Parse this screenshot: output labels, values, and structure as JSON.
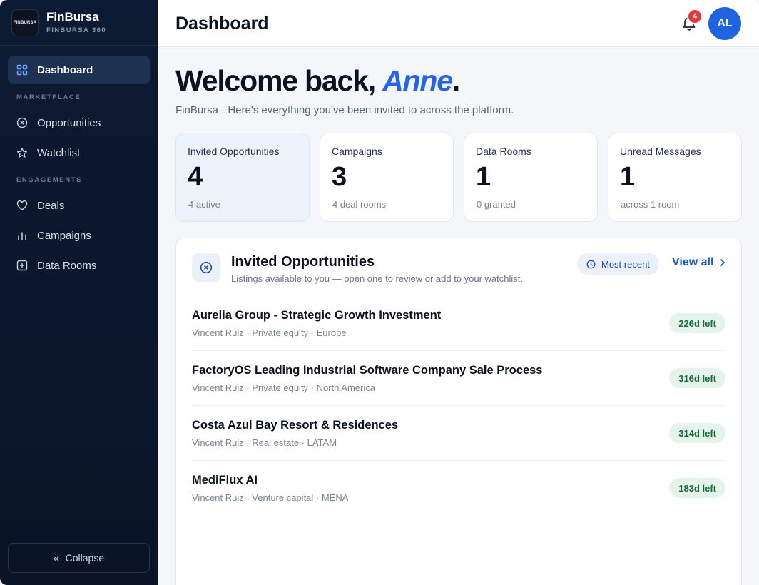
{
  "brand": {
    "logo_text": "FINBURSA",
    "name": "FinBursa",
    "subtitle": "FINBURSA 360"
  },
  "sidebar": {
    "items": [
      {
        "label": "Dashboard",
        "icon": "grid-icon",
        "active": true
      },
      {
        "section": "MARKETPLACE"
      },
      {
        "label": "Opportunities",
        "icon": "circle-x-icon"
      },
      {
        "label": "Watchlist",
        "icon": "star-icon"
      },
      {
        "section": "ENGAGEMENTS"
      },
      {
        "label": "Deals",
        "icon": "heart-icon"
      },
      {
        "label": "Campaigns",
        "icon": "bar-chart-icon"
      },
      {
        "label": "Data Rooms",
        "icon": "plus-square-icon"
      }
    ],
    "collapse_label": "Collapse"
  },
  "header": {
    "title": "Dashboard",
    "notification_count": "4",
    "avatar_initials": "AL"
  },
  "welcome": {
    "prefix": "Welcome back, ",
    "name": "Anne",
    "suffix": ".",
    "subtitle": "FinBursa · Here's everything you've been invited to across the platform."
  },
  "stats": [
    {
      "label": "Invited Opportunities",
      "value": "4",
      "sub": "4 active"
    },
    {
      "label": "Campaigns",
      "value": "3",
      "sub": "4 deal rooms"
    },
    {
      "label": "Data Rooms",
      "value": "1",
      "sub": "0 granted"
    },
    {
      "label": "Unread Messages",
      "value": "1",
      "sub": "across 1 room"
    }
  ],
  "panel": {
    "title": "Invited Opportunities",
    "description": "Listings available to you — open one to review or add to your watchlist.",
    "sort_label": "Most recent",
    "view_all_label": "View all",
    "rows": [
      {
        "title": "Aurelia Group - Strategic Growth Investment",
        "meta": "Vincent Ruiz · Private equity · Europe",
        "pill": "226d left"
      },
      {
        "title": "FactoryOS Leading Industrial Software Company Sale Process",
        "meta": "Vincent Ruiz · Private equity · North America",
        "pill": "316d left"
      },
      {
        "title": "Costa Azul Bay Resort & Residences",
        "meta": "Vincent Ruiz · Real estate · LATAM",
        "pill": "314d left"
      },
      {
        "title": "MediFlux AI",
        "meta": "Vincent Ruiz · Venture capital · MENA",
        "pill": "183d left"
      }
    ]
  },
  "colors": {
    "accent": "#2563eb",
    "sidebar_bg": "#0c1a33",
    "badge": "#e5383b",
    "pill_bg": "#e4f4ea",
    "pill_text": "#176b3a"
  }
}
